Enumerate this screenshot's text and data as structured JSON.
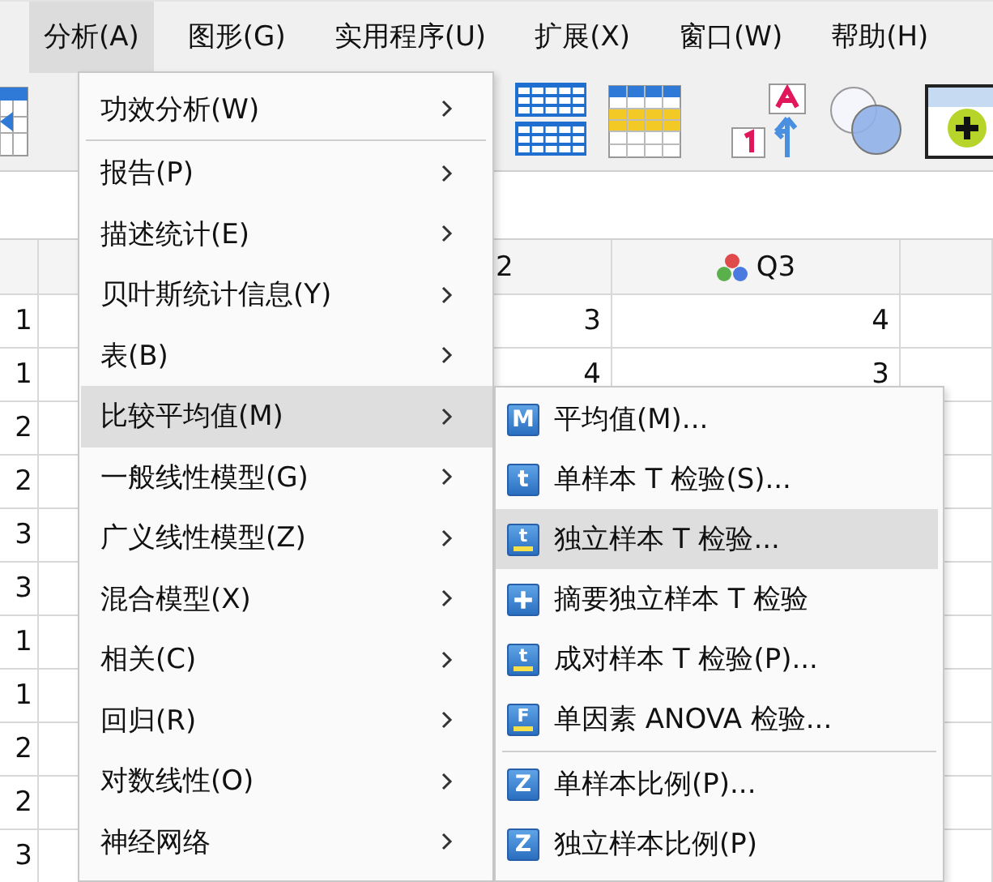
{
  "menubar": {
    "items": [
      {
        "label": "分析(A)",
        "selected": true
      },
      {
        "label": "图形(G)",
        "selected": false
      },
      {
        "label": "实用程序(U)",
        "selected": false
      },
      {
        "label": "扩展(X)",
        "selected": false
      },
      {
        "label": "窗口(W)",
        "selected": false
      },
      {
        "label": "帮助(H)",
        "selected": false
      }
    ]
  },
  "grid": {
    "columns": [
      {
        "label": "2"
      },
      {
        "label": "Q3"
      }
    ],
    "rows": [
      {
        "label": "1",
        "cells": [
          "3",
          "4"
        ]
      },
      {
        "label": "1",
        "cells": [
          "4",
          "3"
        ]
      },
      {
        "label": "2"
      },
      {
        "label": "2"
      },
      {
        "label": "3"
      },
      {
        "label": "3"
      },
      {
        "label": "1"
      },
      {
        "label": "1"
      },
      {
        "label": "2"
      },
      {
        "label": "2"
      },
      {
        "label": "3"
      }
    ]
  },
  "menu": {
    "items": [
      {
        "label": "功效分析(W)",
        "selected": false,
        "separator_after": true
      },
      {
        "label": "报告(P)",
        "selected": false
      },
      {
        "label": "描述统计(E)",
        "selected": false
      },
      {
        "label": "贝叶斯统计信息(Y)",
        "selected": false
      },
      {
        "label": "表(B)",
        "selected": false
      },
      {
        "label": "比较平均值(M)",
        "selected": true
      },
      {
        "label": "一般线性模型(G)",
        "selected": false
      },
      {
        "label": "广义线性模型(Z)",
        "selected": false
      },
      {
        "label": "混合模型(X)",
        "selected": false
      },
      {
        "label": "相关(C)",
        "selected": false
      },
      {
        "label": "回归(R)",
        "selected": false
      },
      {
        "label": "对数线性(O)",
        "selected": false
      },
      {
        "label": "神经网络",
        "selected": false
      }
    ]
  },
  "submenu": {
    "items": [
      {
        "label": "平均值(M)...",
        "selected": false,
        "icon": {
          "kind": "letter",
          "glyph": "M"
        }
      },
      {
        "label": "单样本 T 检验(S)...",
        "selected": false,
        "icon": {
          "kind": "letter",
          "glyph": "t"
        }
      },
      {
        "label": "独立样本 T 检验...",
        "selected": true,
        "icon": {
          "kind": "sub",
          "glyph": "t"
        }
      },
      {
        "label": "摘要独立样本 T 检验",
        "selected": false,
        "icon": {
          "kind": "plus"
        }
      },
      {
        "label": "成对样本 T 检验(P)...",
        "selected": false,
        "icon": {
          "kind": "sub",
          "glyph": "t"
        }
      },
      {
        "label": "单因素 ANOVA 检验...",
        "selected": false,
        "icon": {
          "kind": "sub",
          "glyph": "F"
        },
        "separator_after": true
      },
      {
        "label": "单样本比例(P)...",
        "selected": false,
        "icon": {
          "kind": "letter",
          "glyph": "Z"
        }
      },
      {
        "label": "独立样本比例(P)",
        "selected": false,
        "icon": {
          "kind": "letter",
          "glyph": "Z"
        }
      }
    ]
  }
}
